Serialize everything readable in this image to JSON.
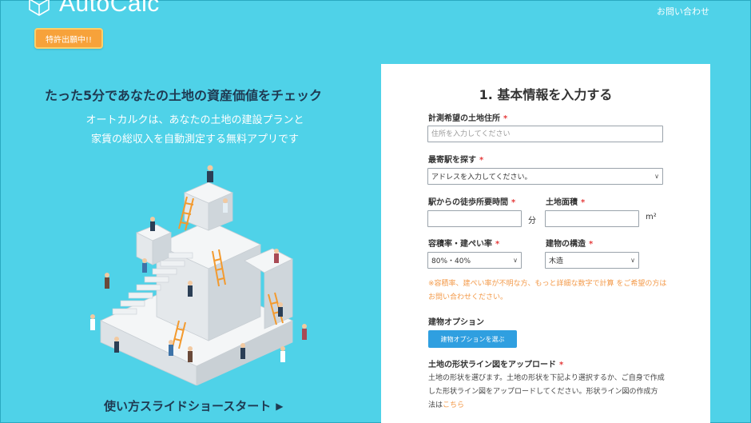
{
  "header": {
    "logo_text": "AutoCalc",
    "logo_icon": "cube-outline-icon",
    "contact_link": "お問い合わせ",
    "patent_badge": "特許出願中!!"
  },
  "hero": {
    "headline": "たった5分であなたの土地の資産価値をチェック",
    "sub_line_1": "オートカルクは、あなたの土地の建設プランと",
    "sub_line_2": "家賃の総収入を自動測定する無料アプリです",
    "illustration": "people-on-blocks-illustration",
    "slideshow_label": "使い方スライドショースタート",
    "slideshow_icon": "▶"
  },
  "form": {
    "title": "1. 基本情報を入力する",
    "required_mark": "*",
    "address": {
      "label": "計測希望の土地住所",
      "placeholder": "住所を入力してください",
      "value": ""
    },
    "station": {
      "label": "最寄駅を探す",
      "selected": "アドレスを入力してください。"
    },
    "walk_time": {
      "label": "駅からの徒歩所要時間",
      "value": "",
      "unit": "分"
    },
    "land_area": {
      "label": "土地面積",
      "value": "",
      "unit": "m²"
    },
    "ratio": {
      "label": "容積率・建ぺい率",
      "selected": "80%・40%"
    },
    "structure": {
      "label": "建物の構造",
      "selected": "木造"
    },
    "note": "※容積率、建ぺい率が不明な方、もっと詳細な数字で計算 をご希望の方はお問い合わせください。",
    "options": {
      "label": "建物オプション",
      "button": "建物オプションを選ぶ"
    },
    "shape_upload": {
      "label": "土地の形状ライン図をアップロード",
      "description": "土地の形状を選びます。土地の形状を下記より選択するか、ご自身で作成した形状ライン図をアップロードしてください。形状ライン図の作成方法は",
      "link_text": "こちら"
    }
  },
  "colors": {
    "background": "#4fd2e8",
    "patent_badge": "#f7a23a",
    "primary_button": "#2f9fe0",
    "note_text": "#f39a4a",
    "required": "#e53b3b",
    "headline": "#1f3a52"
  }
}
